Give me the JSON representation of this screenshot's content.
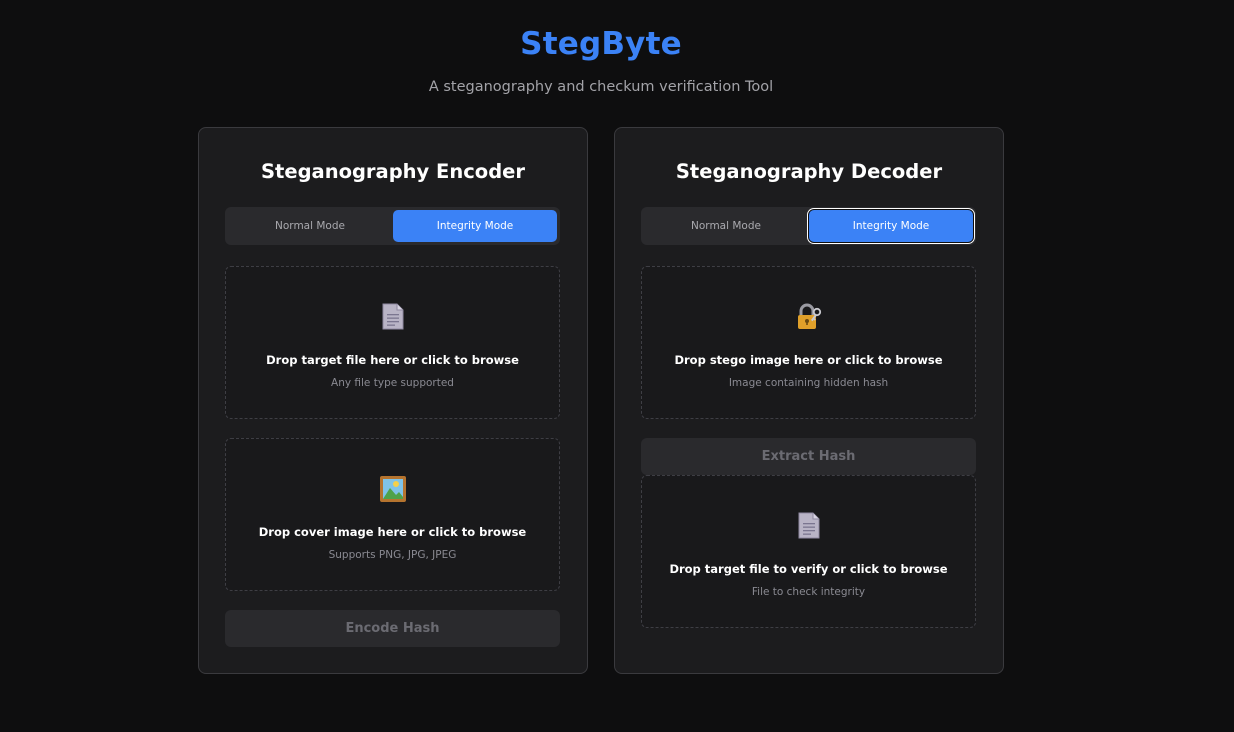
{
  "header": {
    "title": "StegByte",
    "subtitle": "A steganography and checkum verification Tool"
  },
  "encoder": {
    "title": "Steganography Encoder",
    "modes": {
      "normal": "Normal Mode",
      "integrity": "Integrity Mode",
      "active": "integrity"
    },
    "target_drop": {
      "icon": "document-icon",
      "title": "Drop target file here or click to browse",
      "subtitle": "Any file type supported"
    },
    "cover_drop": {
      "icon": "picture-icon",
      "title": "Drop cover image here or click to browse",
      "subtitle": "Supports PNG, JPG, JPEG"
    },
    "action_label": "Encode Hash"
  },
  "decoder": {
    "title": "Steganography Decoder",
    "modes": {
      "normal": "Normal Mode",
      "integrity": "Integrity Mode",
      "active": "integrity"
    },
    "stego_drop": {
      "icon": "lock-key-icon",
      "title": "Drop stego image here or click to browse",
      "subtitle": "Image containing hidden hash"
    },
    "extract_label": "Extract Hash",
    "verify_drop": {
      "icon": "document-icon",
      "title": "Drop target file to verify or click to browse",
      "subtitle": "File to check integrity"
    }
  },
  "colors": {
    "accent": "#3b82f6",
    "background": "#0e0e0f",
    "panel": "#1c1c1e"
  }
}
